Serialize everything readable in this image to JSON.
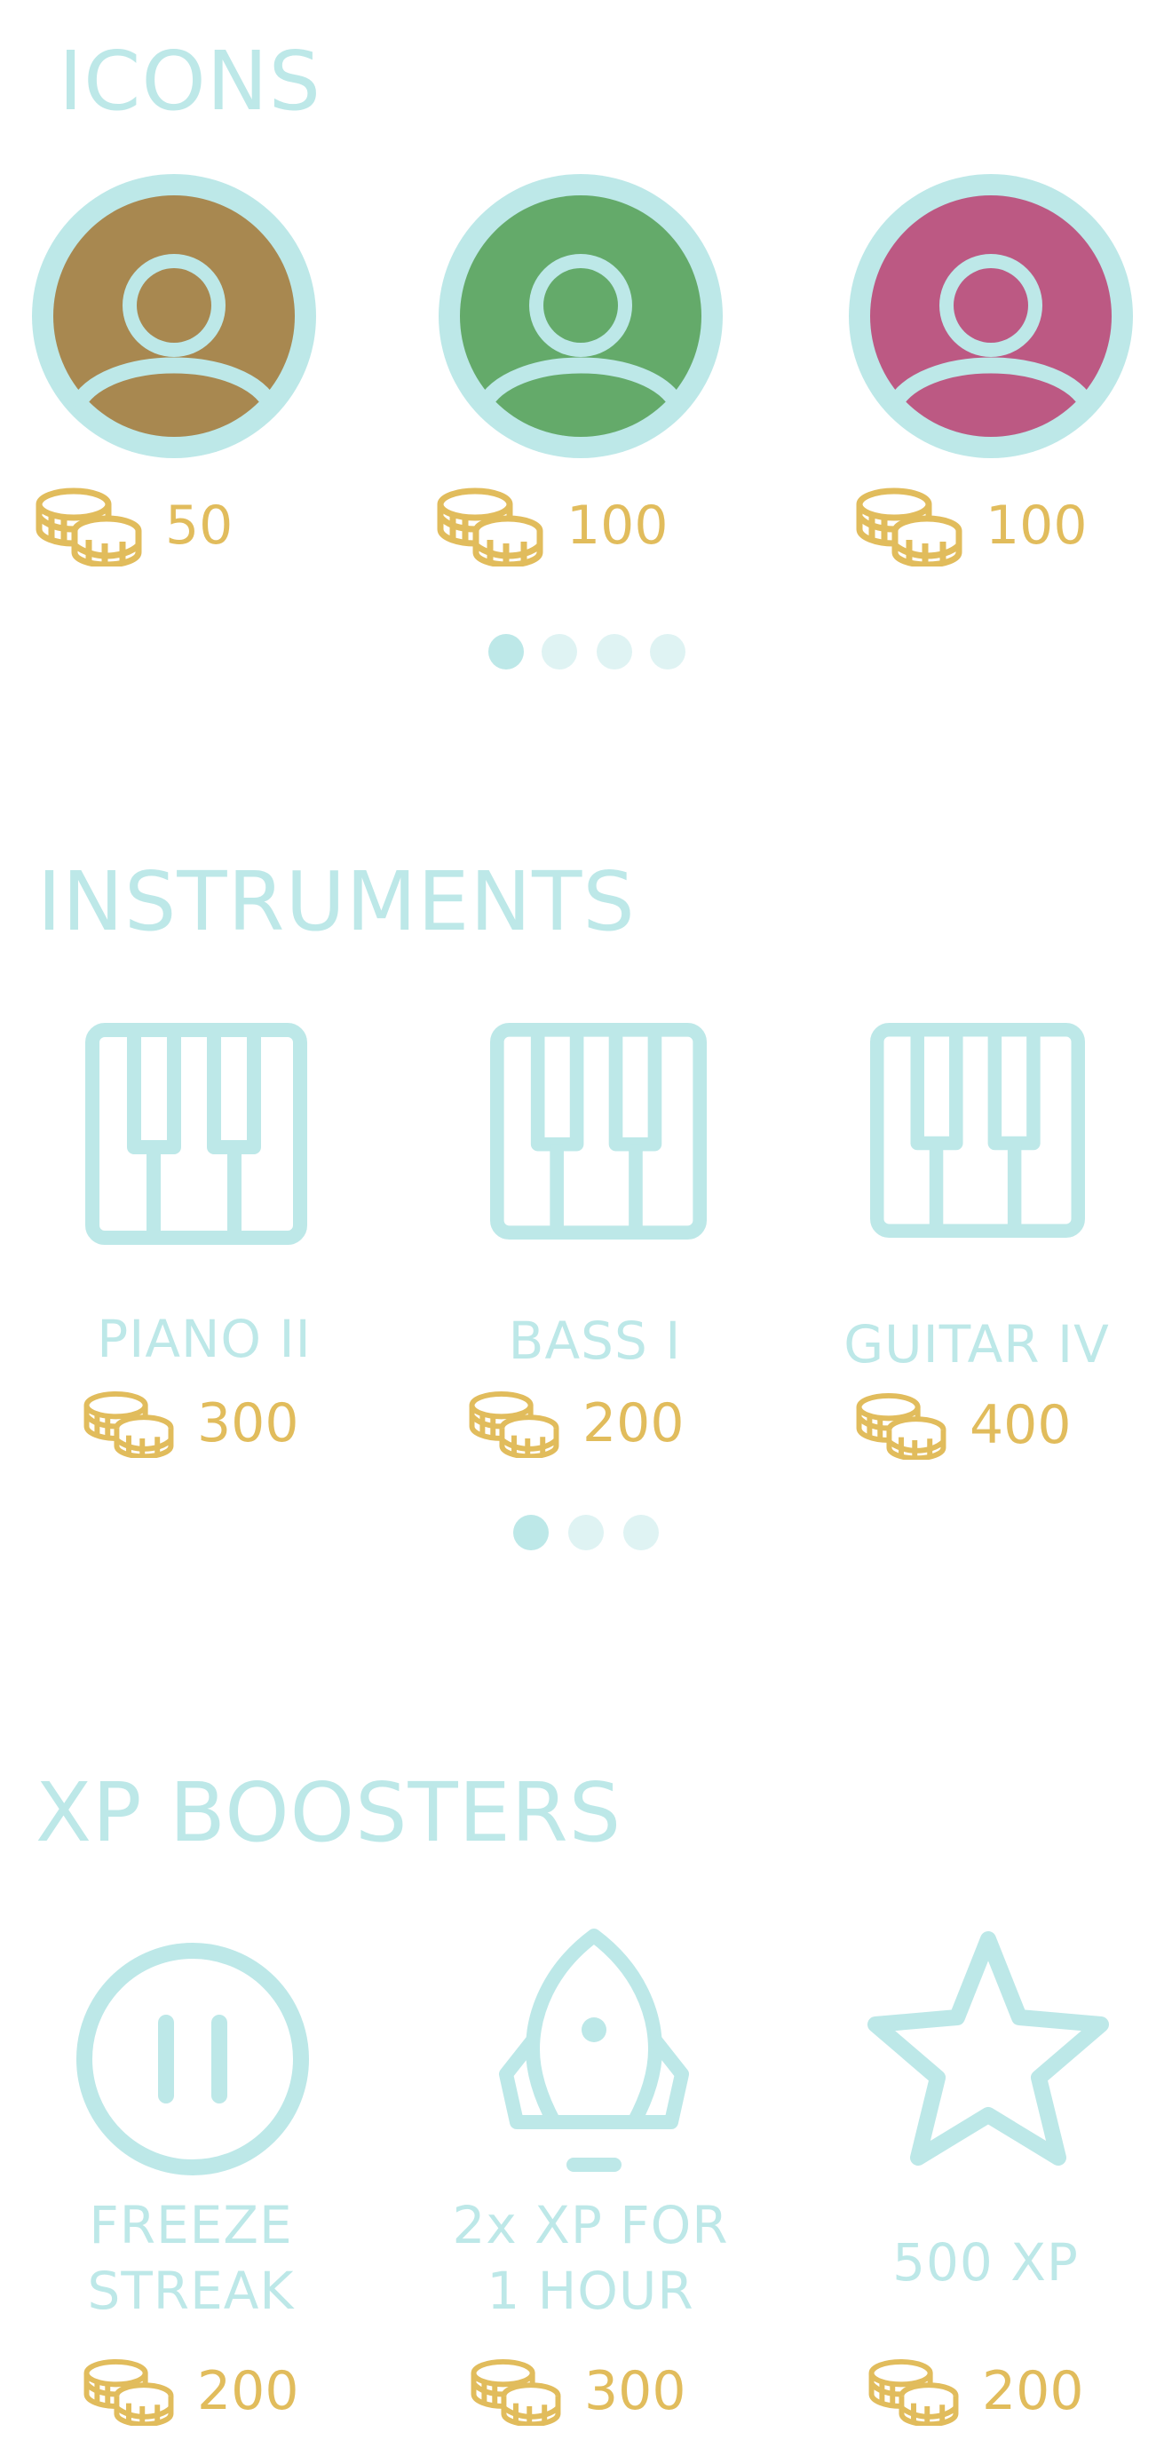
{
  "colors": {
    "accent": "#bde8e8",
    "coin": "#e1bc5c",
    "dot_active": "#bde8e8",
    "dot_inactive": "#dff3f3"
  },
  "icons_section": {
    "title": "ICONS",
    "items": [
      {
        "icon": "user-avatar-icon",
        "color": "#a88850",
        "price": "50"
      },
      {
        "icon": "user-avatar-icon",
        "color": "#64aa6a",
        "price": "100"
      },
      {
        "icon": "user-avatar-icon",
        "color": "#bc5983",
        "price": "100"
      }
    ],
    "pager": {
      "total": 4,
      "active": 1
    }
  },
  "instruments_section": {
    "title": "INSTRUMENTS",
    "items": [
      {
        "icon": "piano-keys-icon",
        "label": "PIANO II",
        "price": "300"
      },
      {
        "icon": "piano-keys-icon",
        "label": "BASS I",
        "price": "200"
      },
      {
        "icon": "piano-keys-icon",
        "label": "GUITAR IV",
        "price": "400"
      }
    ],
    "pager": {
      "total": 3,
      "active": 1
    }
  },
  "xp_section": {
    "title": "XP BOOSTERS",
    "items": [
      {
        "icon": "pause-circle-icon",
        "label_line1": "FREEZE",
        "label_line2": "STREAK",
        "price": "200"
      },
      {
        "icon": "rocket-icon",
        "label_line1": "2x XP FOR",
        "label_line2": "1 HOUR",
        "price": "300"
      },
      {
        "icon": "star-icon",
        "label_line1": "500 XP",
        "label_line2": "",
        "price": "200"
      }
    ]
  }
}
